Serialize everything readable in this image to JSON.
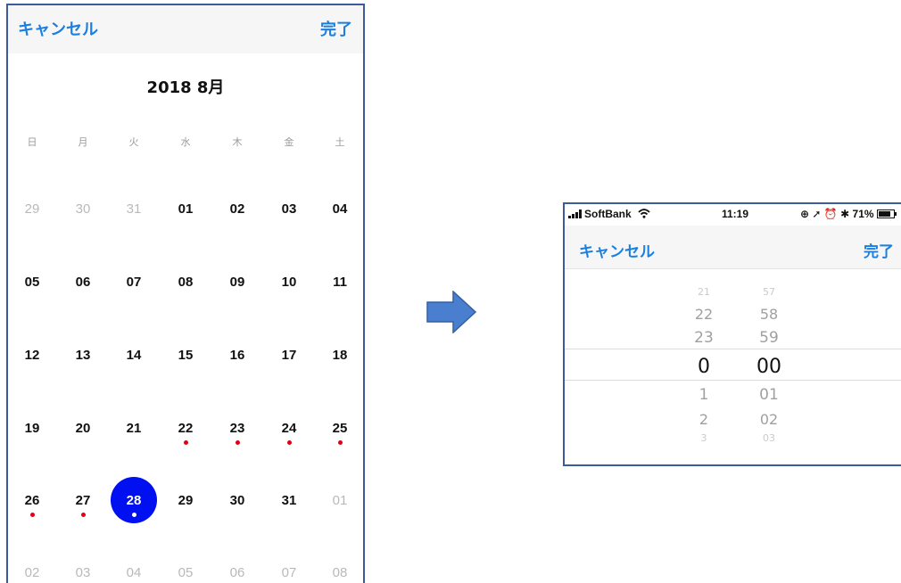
{
  "calendar": {
    "cancel_label": "キャンセル",
    "done_label": "完了",
    "month_title": "2018 8月",
    "weekdays": [
      "日",
      "月",
      "火",
      "水",
      "木",
      "金",
      "土"
    ],
    "weeks": [
      [
        {
          "d": "29",
          "muted": true
        },
        {
          "d": "30",
          "muted": true
        },
        {
          "d": "31",
          "muted": true
        },
        {
          "d": "01"
        },
        {
          "d": "02"
        },
        {
          "d": "03"
        },
        {
          "d": "04"
        }
      ],
      [
        {
          "d": "05"
        },
        {
          "d": "06"
        },
        {
          "d": "07"
        },
        {
          "d": "08"
        },
        {
          "d": "09"
        },
        {
          "d": "10"
        },
        {
          "d": "11"
        }
      ],
      [
        {
          "d": "12"
        },
        {
          "d": "13"
        },
        {
          "d": "14"
        },
        {
          "d": "15"
        },
        {
          "d": "16"
        },
        {
          "d": "17"
        },
        {
          "d": "18"
        }
      ],
      [
        {
          "d": "19"
        },
        {
          "d": "20"
        },
        {
          "d": "21"
        },
        {
          "d": "22",
          "dot": true
        },
        {
          "d": "23",
          "dot": true
        },
        {
          "d": "24",
          "dot": true
        },
        {
          "d": "25",
          "dot": true
        }
      ],
      [
        {
          "d": "26",
          "dot": true
        },
        {
          "d": "27",
          "dot": true
        },
        {
          "d": "28",
          "selected": true,
          "dot": true
        },
        {
          "d": "29"
        },
        {
          "d": "30"
        },
        {
          "d": "31"
        },
        {
          "d": "01",
          "muted": true
        }
      ],
      [
        {
          "d": "02",
          "muted": true
        },
        {
          "d": "03",
          "muted": true
        },
        {
          "d": "04",
          "muted": true
        },
        {
          "d": "05",
          "muted": true
        },
        {
          "d": "06",
          "muted": true
        },
        {
          "d": "07",
          "muted": true
        },
        {
          "d": "08",
          "muted": true
        }
      ]
    ],
    "colors": {
      "accent": "#1a7fe0",
      "selected": "#0010f0",
      "event_dot": "#e0001a",
      "border": "#3c5b9a"
    }
  },
  "arrow": {
    "icon": "right-arrow-icon",
    "color": "#4a7fd0"
  },
  "time_picker": {
    "status_bar": {
      "carrier": "SoftBank",
      "wifi_icon": "wifi-icon",
      "time": "11:19",
      "right_text": "71%",
      "battery_icon": "battery-icon"
    },
    "cancel_label": "キャンセル",
    "done_label": "完了",
    "hours": [
      "21",
      "22",
      "23",
      "0",
      "1",
      "2",
      "3"
    ],
    "minutes": [
      "57",
      "58",
      "59",
      "00",
      "01",
      "02",
      "03"
    ],
    "selected_hour": "0",
    "selected_minute": "00"
  }
}
